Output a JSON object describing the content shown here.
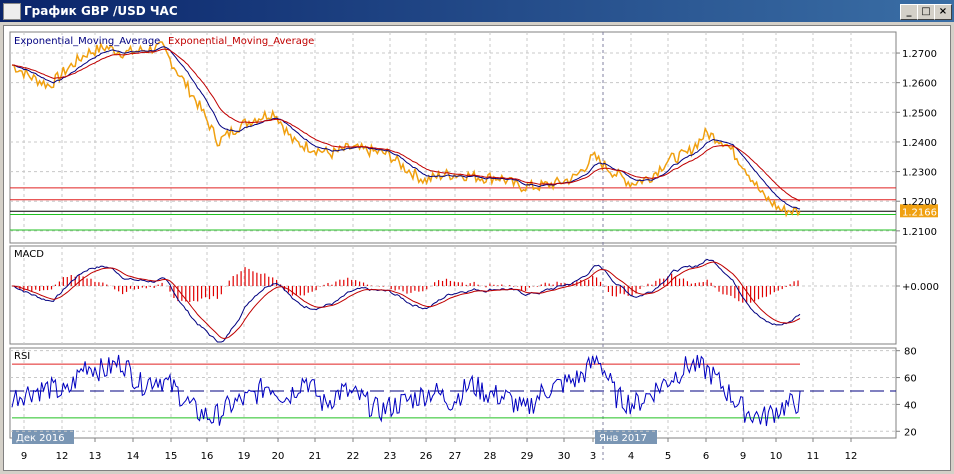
{
  "window": {
    "title": "График GBP /USD  ЧАС",
    "buttons": {
      "minimize": "_",
      "maximize": "□",
      "close": "×"
    }
  },
  "legend": {
    "ema_fast": "Exponential_Moving_Average",
    "ema_slow": "Exponential_Moving_Average"
  },
  "colors": {
    "price": "#f0a010",
    "ema_fast": "#000080",
    "ema_slow": "#c00000",
    "level_red": "#e02020",
    "level_green": "#20c020",
    "rsi": "#0000c0"
  },
  "macd_label": "MACD",
  "rsi_label": "RSI",
  "current_price": "1.2166",
  "chart_data": {
    "type": "line",
    "price_axis": {
      "ticks": [
        "1.2700",
        "1.2600",
        "1.2500",
        "1.2400",
        "1.2300",
        "1.2200",
        "1.2100"
      ],
      "range": [
        1.2059,
        1.2771
      ]
    },
    "macd_axis": {
      "ticks": [
        "+0.000"
      ]
    },
    "rsi_axis": {
      "ticks": [
        "80",
        "60",
        "40",
        "20"
      ],
      "range": [
        15,
        82
      ],
      "levels": [
        70,
        50,
        30
      ]
    },
    "levels": [
      {
        "value": 1.2245,
        "color": "red"
      },
      {
        "value": 1.2205,
        "color": "red"
      },
      {
        "value": 1.2166,
        "color": "black"
      },
      {
        "value": 1.2155,
        "color": "green"
      },
      {
        "value": 1.2103,
        "color": "green"
      }
    ],
    "month_labels": [
      "Дек 2016",
      "Янв 2017"
    ],
    "x_labels": [
      "9",
      "12",
      "13",
      "14",
      "15",
      "16",
      "19",
      "20",
      "21",
      "22",
      "23",
      "26",
      "27",
      "28",
      "29",
      "30",
      "3",
      "4",
      "5",
      "6",
      "9",
      "10",
      "11",
      "12"
    ],
    "price": [
      1.266,
      1.262,
      1.259,
      1.265,
      1.27,
      1.272,
      1.27,
      1.271,
      1.272,
      1.262,
      1.252,
      1.24,
      1.245,
      1.248,
      1.25,
      1.24,
      1.238,
      1.236,
      1.238,
      1.237,
      1.236,
      1.231,
      1.227,
      1.229,
      1.229,
      1.228,
      1.228,
      1.225,
      1.225,
      1.226,
      1.228,
      1.235,
      1.23,
      1.226,
      1.228,
      1.234,
      1.236,
      1.243,
      1.24,
      1.232,
      1.222,
      1.217,
      1.2166
    ],
    "rsi": [
      45,
      50,
      52,
      48,
      70,
      65,
      72,
      55,
      60,
      50,
      35,
      30,
      40,
      45,
      55,
      45,
      60,
      40,
      50,
      45,
      35,
      40,
      45,
      50,
      42,
      55,
      48,
      45,
      35,
      50,
      55,
      60,
      75,
      45,
      40,
      50,
      60,
      70,
      65,
      50,
      35,
      30,
      38,
      42
    ]
  }
}
